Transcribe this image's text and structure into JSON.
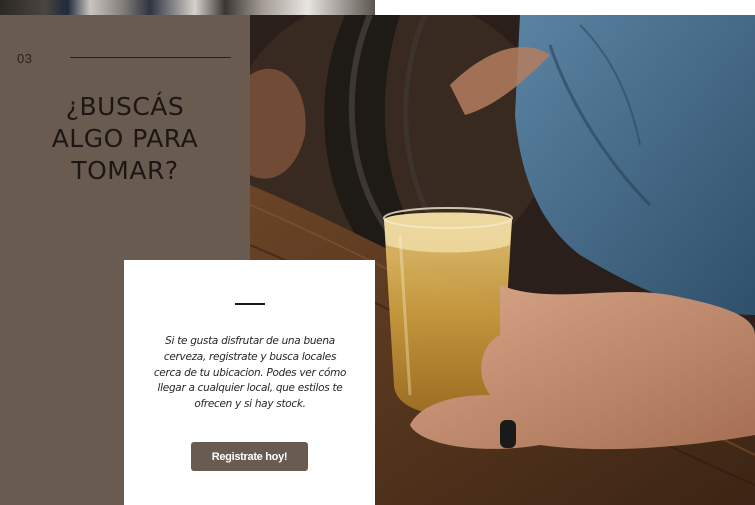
{
  "section": {
    "number": "03",
    "title_lines": [
      "¿BUSCÁS",
      "ALGO PARA",
      "TOMAR?"
    ]
  },
  "card": {
    "description": "Si te gusta disfrutar de una buena cerveza, registrate y busca locales cerca de tu ubicacion. Podes ver cómo llegar a cualquier local, que estilos te ofrecen y si hay stock.",
    "button_label": "Registrate hoy!"
  },
  "colors": {
    "panel": "#6a5b51",
    "button": "#6a5b51",
    "text_dark": "#1c1714"
  }
}
